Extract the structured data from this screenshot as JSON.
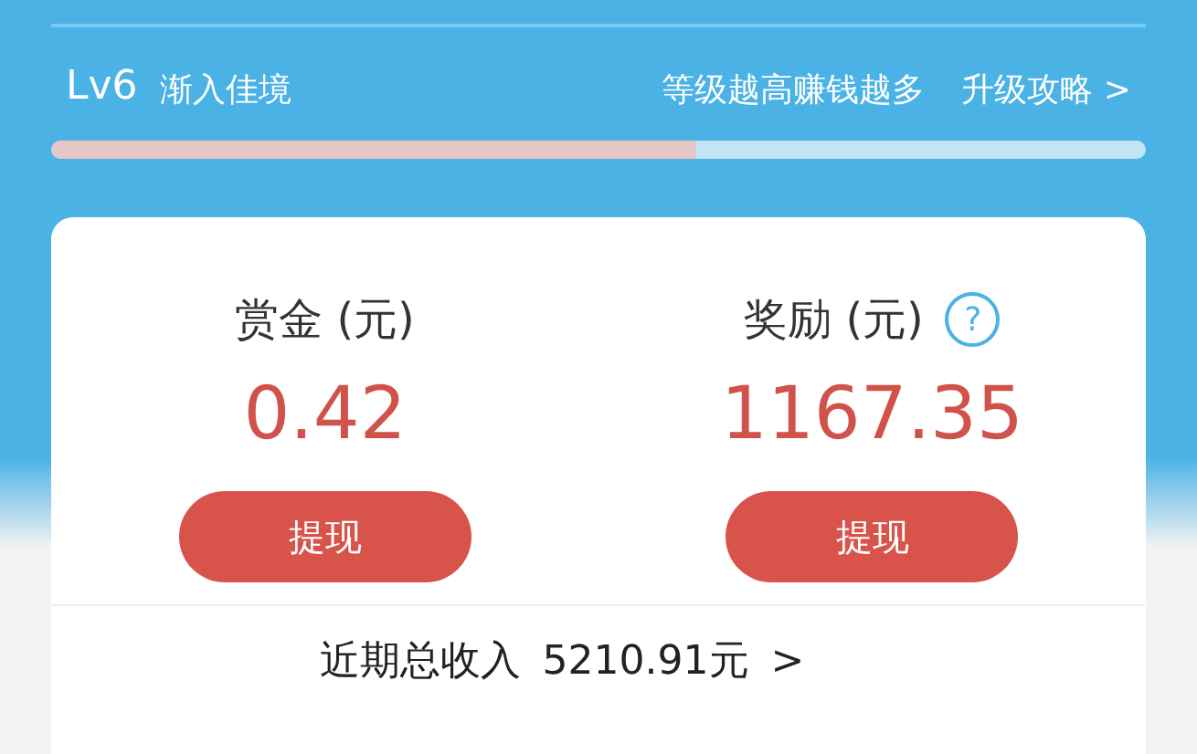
{
  "level": {
    "badge": "Lv6",
    "title": "渐入佳境",
    "hint": "等级越高赚钱越多",
    "link": "升级攻略 >",
    "level": 0.59
  },
  "balances": [
    {
      "label": "赏金 (元)",
      "amount": "0.42",
      "button": "提现",
      "help": false
    },
    {
      "label": "奖励 (元)",
      "amount": "1167.35",
      "button": "提现",
      "help": true,
      "help_text": "?"
    }
  ],
  "total": {
    "label": "近期总收入",
    "amount": "5210.91元",
    "arrow": ">"
  }
}
